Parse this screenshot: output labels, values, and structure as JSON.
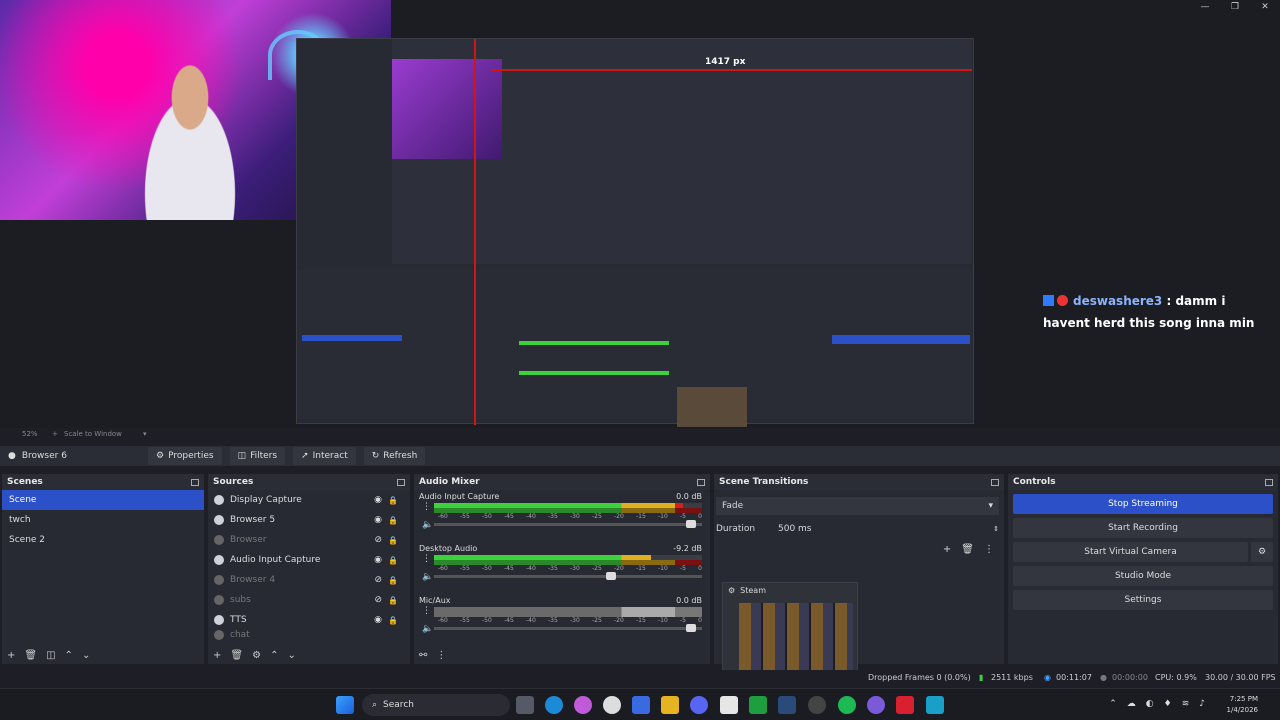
{
  "window": {
    "minimize": "—",
    "maximize": "❐",
    "close": "✕"
  },
  "preview": {
    "dimension_label": "1417 px",
    "zoom": "52%",
    "scale_mode": "Scale to Window"
  },
  "chat": {
    "username": "deswashere3",
    "separator": " : ",
    "message": "damm i havent herd this song inna min"
  },
  "context_bar": {
    "source_name": "Browser 6",
    "properties": "Properties",
    "filters": "Filters",
    "interact": "Interact",
    "refresh": "Refresh"
  },
  "scenes": {
    "title": "Scenes",
    "items": [
      "Scene",
      "twch",
      "Scene 2"
    ],
    "selected": 0
  },
  "sources": {
    "title": "Sources",
    "items": [
      {
        "label": "Display Capture",
        "visible": true
      },
      {
        "label": "Browser 5",
        "visible": true
      },
      {
        "label": "Browser",
        "visible": false
      },
      {
        "label": "Audio Input Capture",
        "visible": true
      },
      {
        "label": "Browser 4",
        "visible": false
      },
      {
        "label": "subs",
        "visible": false
      },
      {
        "label": "TTS",
        "visible": true
      },
      {
        "label": "chat",
        "visible": false
      }
    ]
  },
  "audio_mixer": {
    "title": "Audio Mixer",
    "ticks": [
      "-60",
      "-55",
      "-50",
      "-45",
      "-40",
      "-35",
      "-30",
      "-25",
      "-20",
      "-15",
      "-10",
      "-5",
      "0"
    ],
    "channels": [
      {
        "name": "Audio Input Capture",
        "db": "0.0 dB",
        "level": 0.93,
        "fader": 0.96
      },
      {
        "name": "Desktop Audio",
        "db": "-9.2 dB",
        "level": 0.81,
        "fader": 0.66
      },
      {
        "name": "Mic/Aux",
        "db": "0.0 dB",
        "level": 0.0,
        "fader": 0.96
      }
    ]
  },
  "scene_transitions": {
    "title": "Scene Transitions",
    "transition": "Fade",
    "duration_label": "Duration",
    "duration_value": "500 ms"
  },
  "steam_window": {
    "title": "Steam"
  },
  "controls": {
    "title": "Controls",
    "buttons": [
      "Stop Streaming",
      "Start Recording",
      "Start Virtual Camera",
      "Studio Mode",
      "Settings"
    ]
  },
  "status_bar": {
    "dropped_frames": "Dropped Frames 0 (0.0%)",
    "bitrate": "2511 kbps",
    "stream_time": "00:11:07",
    "record_time": "00:00:00",
    "cpu": "CPU: 0.9%",
    "fps": "30.00 / 30.00 FPS"
  },
  "taskbar": {
    "search_label": "Search",
    "time": "7:25 PM",
    "date": "1/4/2026"
  },
  "colors": {
    "accent": "#2c50c7",
    "meter_green": "#3ed13e",
    "meter_yellow": "#e0b020",
    "meter_red": "#d02020"
  }
}
